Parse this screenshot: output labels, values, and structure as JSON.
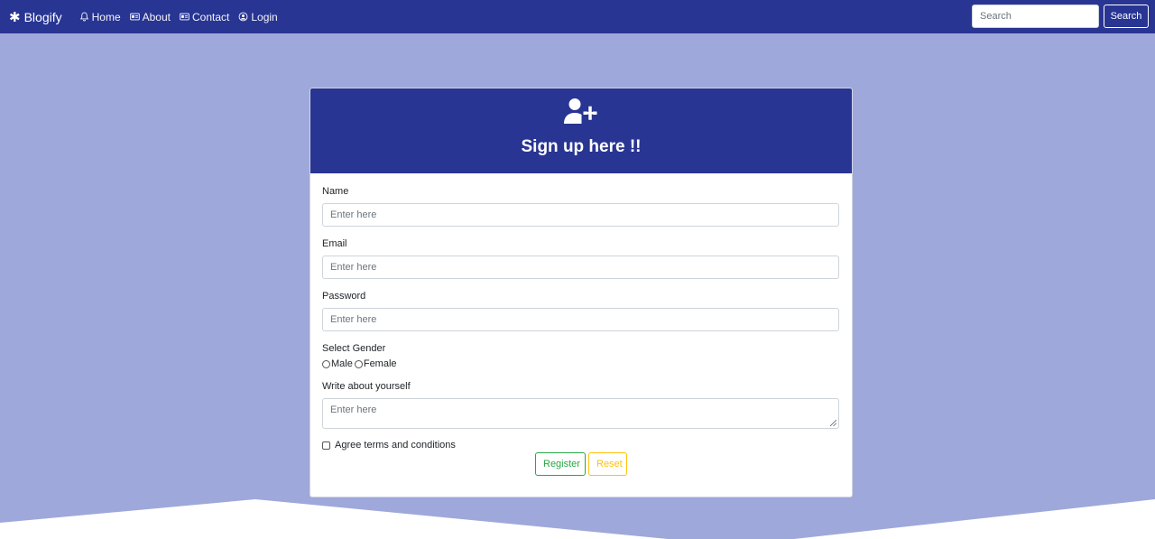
{
  "navbar": {
    "brand": "Blogify",
    "links": [
      {
        "label": "Home",
        "icon": "bell-icon"
      },
      {
        "label": "About",
        "icon": "id-card-icon"
      },
      {
        "label": "Contact",
        "icon": "address-card-icon"
      },
      {
        "label": "Login",
        "icon": "user-circle-icon"
      }
    ],
    "search_placeholder": "Search",
    "search_button": "Search"
  },
  "card": {
    "title": "Sign up here !!",
    "header_icon": "user-plus-icon",
    "fields": [
      {
        "label": "Name",
        "placeholder": "Enter here"
      },
      {
        "label": "Email",
        "placeholder": "Enter here"
      },
      {
        "label": "Password",
        "placeholder": "Enter here"
      }
    ],
    "gender_label": "Select Gender",
    "gender_options": [
      "Male",
      "Female"
    ],
    "about_label": "Write about yourself",
    "about_placeholder": "Enter here",
    "agree_label": "Agree terms and conditions",
    "register_button": "Register",
    "reset_button": "Reset"
  },
  "colors": {
    "primary": "#283593",
    "background": "#9fa8da",
    "register": "#28a745",
    "reset": "#ffc107"
  }
}
